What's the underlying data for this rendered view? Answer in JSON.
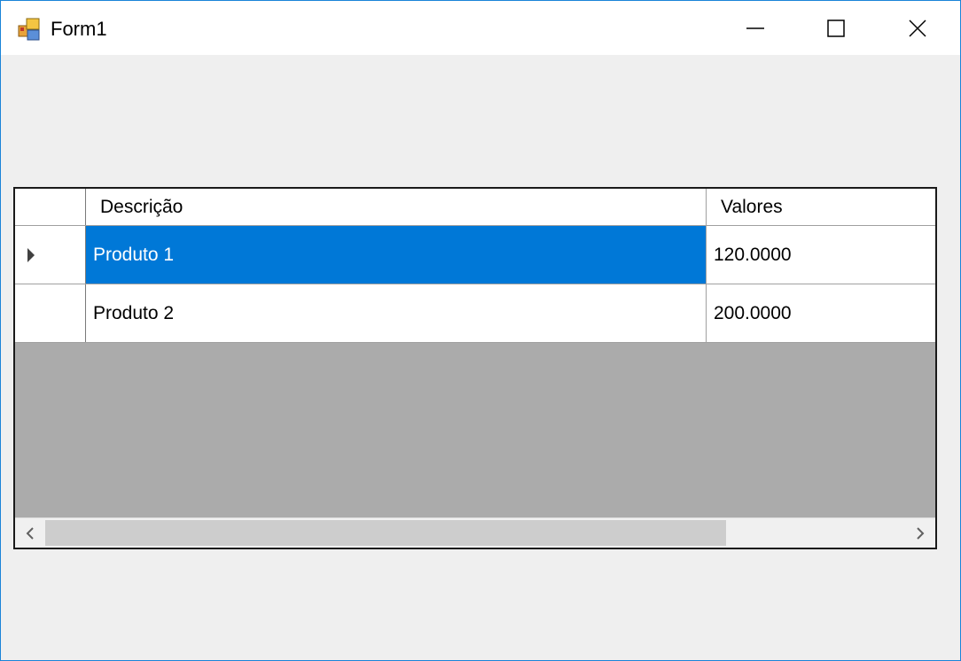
{
  "window": {
    "title": "Form1",
    "icon": "form-app-icon",
    "controls": {
      "minimize": "minimize-icon",
      "maximize": "maximize-icon",
      "close": "close-icon"
    }
  },
  "grid": {
    "columns": [
      "Descrição",
      "Valores"
    ],
    "rows": [
      {
        "descricao": "Produto 1",
        "valores": "120.0000",
        "selected": true
      },
      {
        "descricao": "Produto 2",
        "valores": "200.0000",
        "selected": false
      }
    ],
    "current_row_indicator": "row-indicator-icon",
    "scrollbar": {
      "left": "chevron-left-icon",
      "right": "chevron-right-icon"
    }
  },
  "colors": {
    "selection": "#0078d7",
    "grid_background": "#ababab",
    "window_border": "#1a84d8",
    "form_background": "#efefef"
  }
}
